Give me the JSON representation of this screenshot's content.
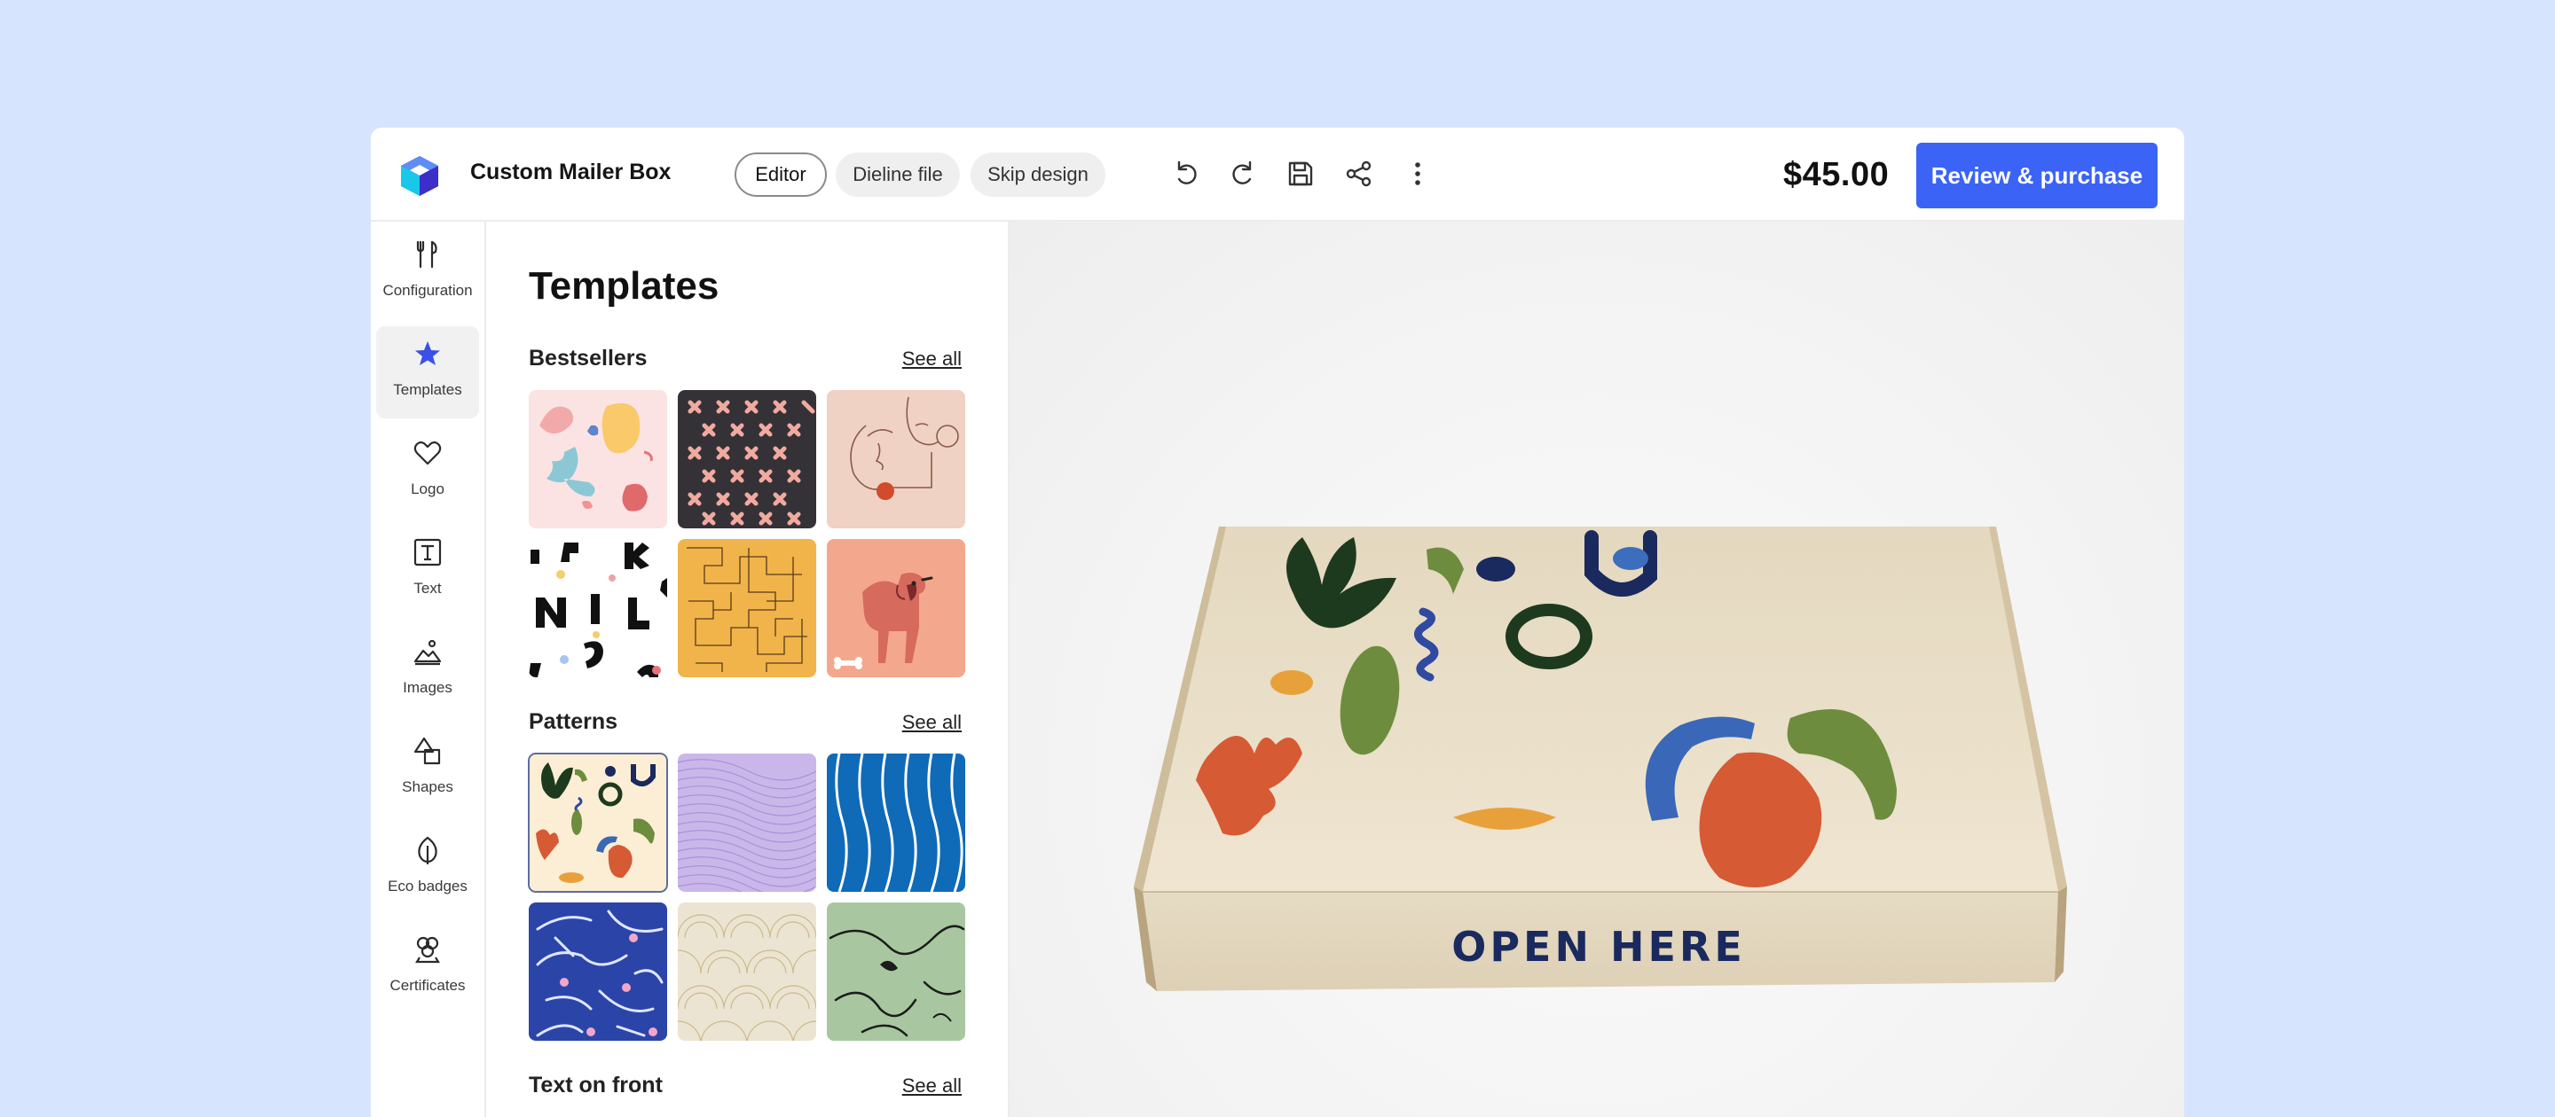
{
  "header": {
    "title": "Custom Mailer Box",
    "tabs": [
      {
        "label": "Editor",
        "active": true
      },
      {
        "label": "Dieline file",
        "active": false
      },
      {
        "label": "Skip design",
        "active": false
      }
    ],
    "tools": [
      "undo-icon",
      "redo-icon",
      "save-icon",
      "share-icon",
      "more-vertical-icon"
    ],
    "price": "$45.00",
    "cta_label": "Review & purchase",
    "accent_color": "#3b63f6"
  },
  "rail": {
    "items": [
      {
        "label": "Configuration",
        "icon": "tools-icon",
        "active": false
      },
      {
        "label": "Templates",
        "icon": "star-icon",
        "active": true
      },
      {
        "label": "Logo",
        "icon": "heart-icon",
        "active": false
      },
      {
        "label": "Text",
        "icon": "text-icon",
        "active": false
      },
      {
        "label": "Images",
        "icon": "image-icon",
        "active": false
      },
      {
        "label": "Shapes",
        "icon": "shapes-icon",
        "active": false
      },
      {
        "label": "Eco badges",
        "icon": "leaf-icon",
        "active": false
      },
      {
        "label": "Certificates",
        "icon": "certificate-icon",
        "active": false
      }
    ]
  },
  "panel": {
    "title": "Templates",
    "sections": [
      {
        "title": "Bestsellers",
        "see_all": "See all"
      },
      {
        "title": "Patterns",
        "see_all": "See all"
      },
      {
        "title": "Text on front",
        "see_all": "See all"
      }
    ]
  },
  "canvas": {
    "box_text": "OPEN HERE"
  }
}
